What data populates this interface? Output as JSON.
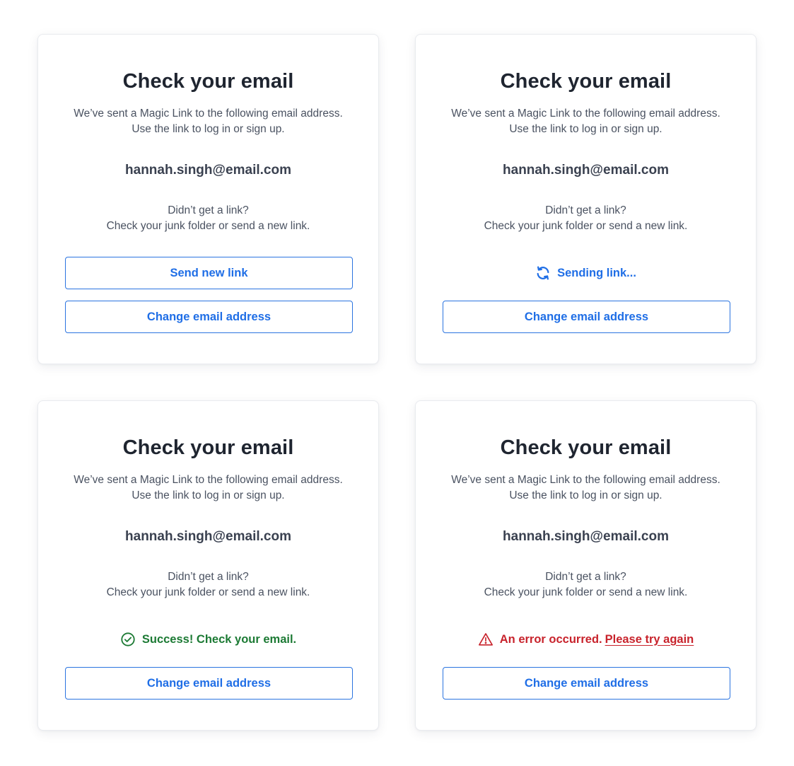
{
  "colors": {
    "primary": "#1f6ee6",
    "success": "#1c7a34",
    "error": "#c8232c",
    "title": "#1f2530",
    "body_text": "#4a5261"
  },
  "cards": [
    {
      "title": "Check your email",
      "description_line1": "We’ve sent a Magic Link to the following email address.",
      "description_line2": "Use the link to log in or sign up.",
      "email": "hannah.singh@email.com",
      "help_line1": "Didn’t get a link?",
      "help_line2": "Check your junk folder or send a new link.",
      "send_button_label": "Send new link",
      "change_button_label": "Change email address"
    },
    {
      "title": "Check your email",
      "description_line1": "We’ve sent a Magic Link to the following email address.",
      "description_line2": "Use the link to log in or sign up.",
      "email": "hannah.singh@email.com",
      "help_line1": "Didn’t get a link?",
      "help_line2": "Check your junk folder or send a new link.",
      "status_text": "Sending link...",
      "status_icon": "refresh-icon",
      "change_button_label": "Change email address"
    },
    {
      "title": "Check your email",
      "description_line1": "We’ve sent a Magic Link to the following email address.",
      "description_line2": "Use the link to log in or sign up.",
      "email": "hannah.singh@email.com",
      "help_line1": "Didn’t get a link?",
      "help_line2": "Check your junk folder or send a new link.",
      "status_text": "Success! Check your email.",
      "status_icon": "check-circle-icon",
      "change_button_label": "Change email address"
    },
    {
      "title": "Check your email",
      "description_line1": "We’ve sent a Magic Link to the following email address.",
      "description_line2": "Use the link to log in or sign up.",
      "email": "hannah.singh@email.com",
      "help_line1": "Didn’t get a link?",
      "help_line2": "Check your junk folder or send a new link.",
      "status_text": "An error occurred.",
      "retry_link_text": "Please try again",
      "status_icon": "warning-triangle-icon",
      "change_button_label": "Change email address"
    }
  ]
}
